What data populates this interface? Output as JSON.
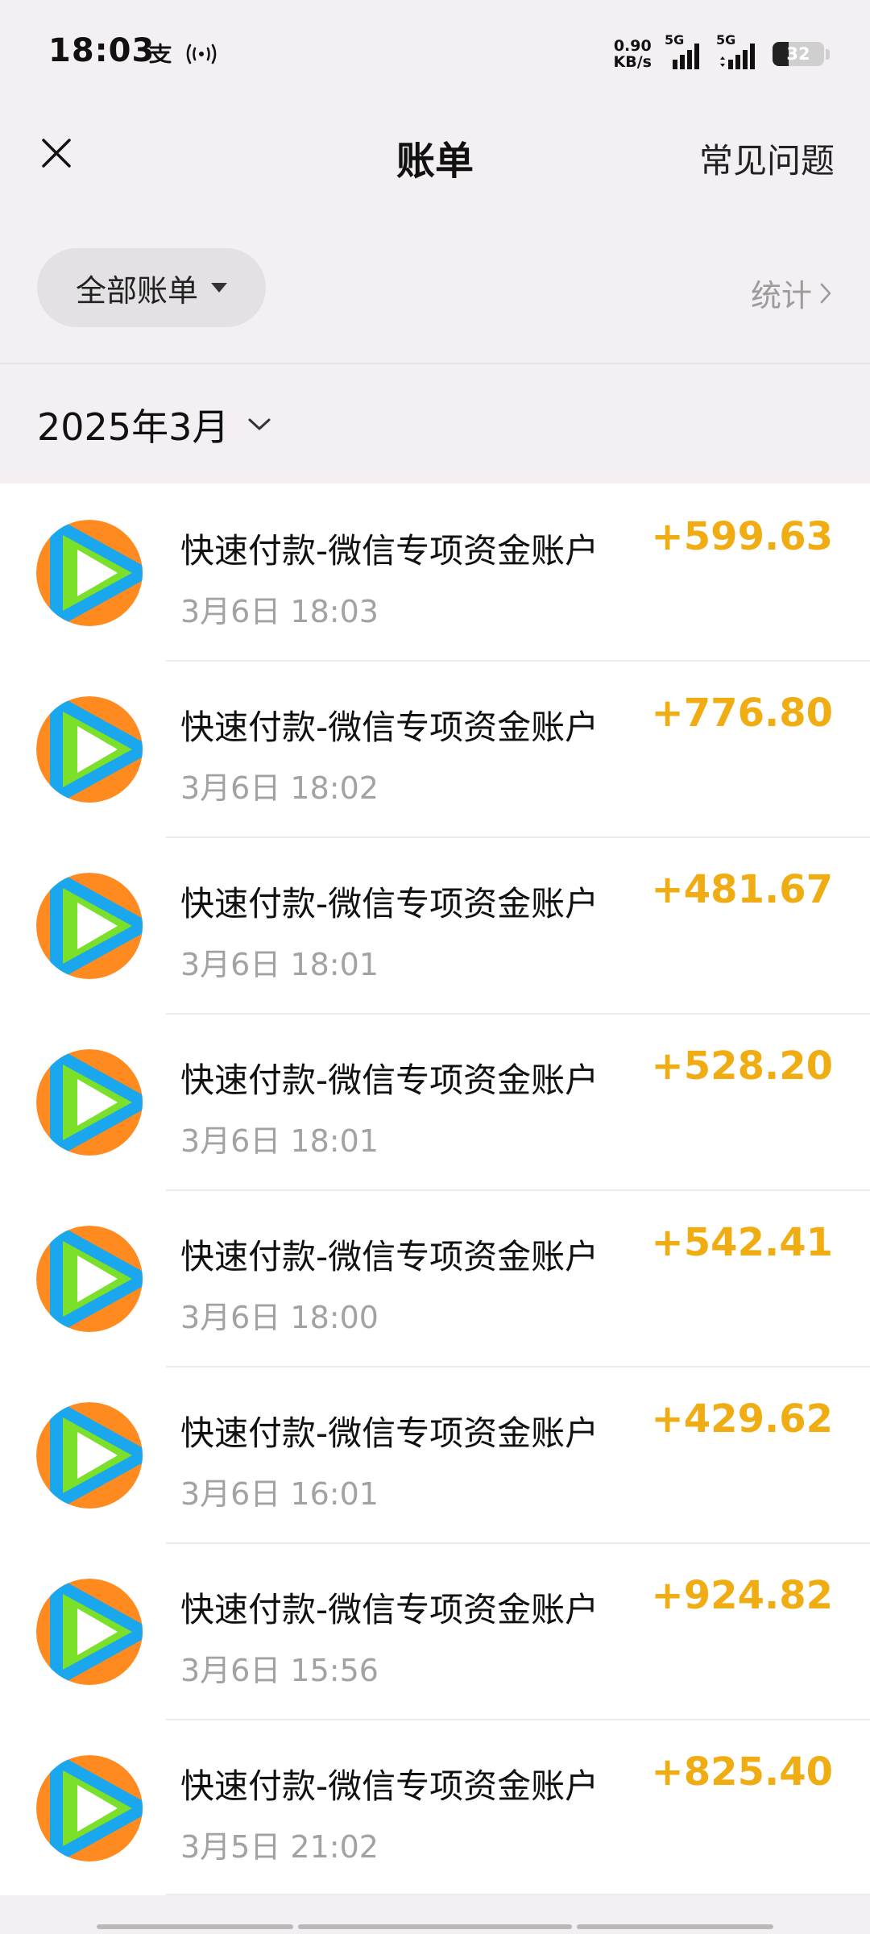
{
  "status_bar": {
    "time": "18:03",
    "net_speed_value": "0.90",
    "net_speed_unit": "KB/s",
    "signal1_label": "5G",
    "signal2_label": "5G",
    "battery_level": "32",
    "battery_fraction": 0.32
  },
  "header": {
    "title": "账单",
    "faq_label": "常见问题"
  },
  "filter": {
    "all_bills_label": "全部账单",
    "stats_label": "统计"
  },
  "month": {
    "label": "2025年3月"
  },
  "bills": [
    {
      "title": "快速付款-微信专项资金账户",
      "time": "3月6日 18:03",
      "amount": "+599.63"
    },
    {
      "title": "快速付款-微信专项资金账户",
      "time": "3月6日 18:02",
      "amount": "+776.80"
    },
    {
      "title": "快速付款-微信专项资金账户",
      "time": "3月6日 18:01",
      "amount": "+481.67"
    },
    {
      "title": "快速付款-微信专项资金账户",
      "time": "3月6日 18:01",
      "amount": "+528.20"
    },
    {
      "title": "快速付款-微信专项资金账户",
      "time": "3月6日 18:00",
      "amount": "+542.41"
    },
    {
      "title": "快速付款-微信专项资金账户",
      "time": "3月6日 16:01",
      "amount": "+429.62"
    },
    {
      "title": "快速付款-微信专项资金账户",
      "time": "3月6日 15:56",
      "amount": "+924.82"
    },
    {
      "title": "快速付款-微信专项资金账户",
      "time": "3月5日 21:02",
      "amount": "+825.40"
    }
  ],
  "colors": {
    "amount": "#f0ad13",
    "background": "#f3eff3",
    "muted_text": "#a2a2a2"
  },
  "icons": {
    "close": "close-icon",
    "dropdown": "triangle-down-icon",
    "stats_arrow": "chevron-right-icon",
    "month_arrow": "chevron-down-icon",
    "bill_logo": "video-app-logo-icon"
  }
}
